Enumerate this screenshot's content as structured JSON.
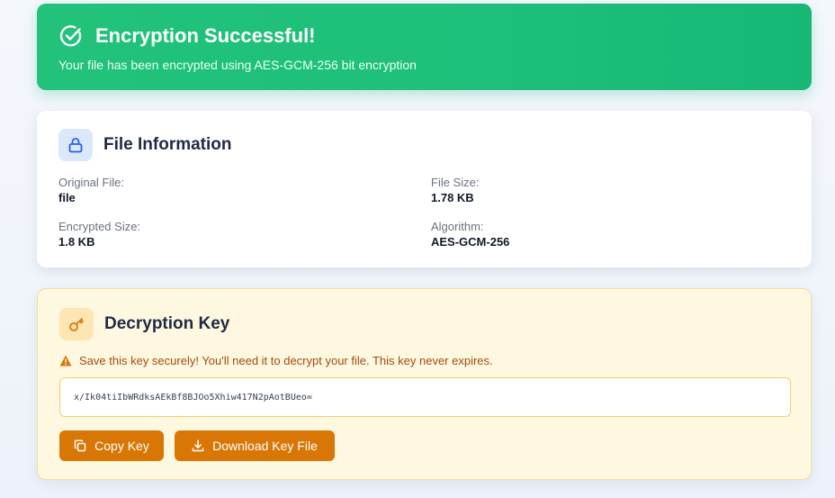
{
  "banner": {
    "icon": "check-circle-icon",
    "title": "Encryption Successful!",
    "subtitle": "Your file has been encrypted using AES-GCM-256 bit encryption"
  },
  "file_info": {
    "icon": "lock-icon",
    "title": "File Information",
    "fields": [
      {
        "label": "Original File:",
        "value": "file"
      },
      {
        "label": "File Size:",
        "value": "1.78 KB"
      },
      {
        "label": "Encrypted Size:",
        "value": "1.8 KB"
      },
      {
        "label": "Algorithm:",
        "value": "AES-GCM-256"
      }
    ]
  },
  "decryption_key": {
    "icon": "key-icon",
    "title": "Decryption Key",
    "warning_icon": "warning-icon",
    "warning": "Save this key securely! You'll need it to decrypt your file. This key never expires.",
    "key_value": "x/Ik04tiIbWRdksAEkBf8BJOo5Xhiw417N2pAotBUeo=",
    "copy_label": "Copy Key",
    "download_label": "Download Key File"
  },
  "colors": {
    "success": "#1dbf7a",
    "accent": "#d97706",
    "key_bg": "#fff8e1",
    "warning_text": "#a34b0c"
  }
}
